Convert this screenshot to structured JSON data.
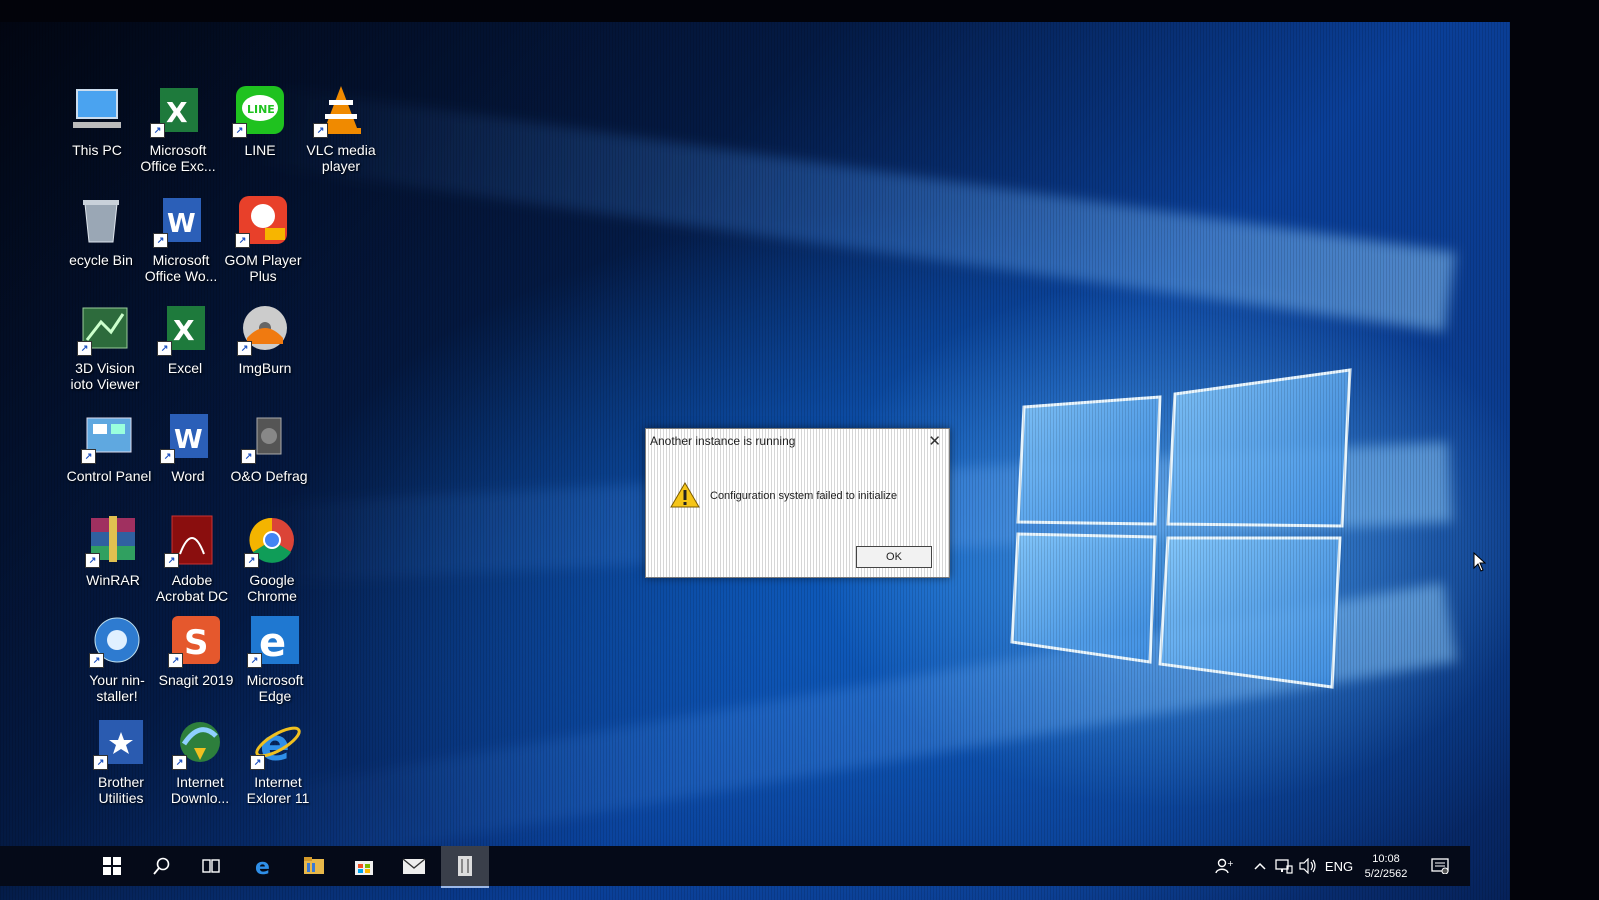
{
  "desktop": {
    "icons": [
      {
        "label": "This PC",
        "icon": "this-pc-icon"
      },
      {
        "label": "Microsoft Office Exc...",
        "icon": "excel-icon"
      },
      {
        "label": "LINE",
        "icon": "line-app-icon"
      },
      {
        "label": "VLC media player",
        "icon": "vlc-cone-icon"
      },
      {
        "label": "ecycle Bin",
        "icon": "recycle-bin-icon"
      },
      {
        "label": "Microsoft Office Wo...",
        "icon": "word-icon"
      },
      {
        "label": "GOM Player Plus",
        "icon": "gom-player-icon"
      },
      {
        "label": "3D Vision ioto Viewer",
        "icon": "3d-vision-icon"
      },
      {
        "label": "Excel",
        "icon": "excel-icon"
      },
      {
        "label": "ImgBurn",
        "icon": "imgburn-icon"
      },
      {
        "label": "Control Panel",
        "icon": "control-panel-icon"
      },
      {
        "label": "Word",
        "icon": "word-icon"
      },
      {
        "label": "O&O Defrag",
        "icon": "defrag-icon"
      },
      {
        "label": "WinRAR",
        "icon": "winrar-icon"
      },
      {
        "label": "Adobe Acrobat DC",
        "icon": "acrobat-icon"
      },
      {
        "label": "Google Chrome",
        "icon": "chrome-icon"
      },
      {
        "label": "Your nin-staller!",
        "icon": "uninstaller-icon"
      },
      {
        "label": "Snagit 2019",
        "icon": "snagit-icon"
      },
      {
        "label": "Microsoft Edge",
        "icon": "edge-icon"
      },
      {
        "label": "Brother Utilities",
        "icon": "brother-utilities-icon"
      },
      {
        "label": "Internet Downlo...",
        "icon": "idm-icon"
      },
      {
        "label": "Internet Exlorer 11",
        "icon": "ie-icon"
      }
    ]
  },
  "dialog": {
    "title": "Another instance is running",
    "message": "Configuration system failed to initialize",
    "ok_label": "OK",
    "close_glyph": "✕",
    "icon": "warning-icon"
  },
  "taskbar": {
    "items": [
      "start-icon",
      "search-icon",
      "task-view-icon",
      "edge-icon",
      "file-explorer-icon",
      "store-icon",
      "mail-icon",
      "open-app-icon"
    ],
    "tray": {
      "language": "ENG",
      "time": "10:08",
      "date": "5/2/2562"
    }
  },
  "colors": {
    "accent": "#0a3f98",
    "taskbar": "#050a18",
    "warning": "#f5c518"
  }
}
